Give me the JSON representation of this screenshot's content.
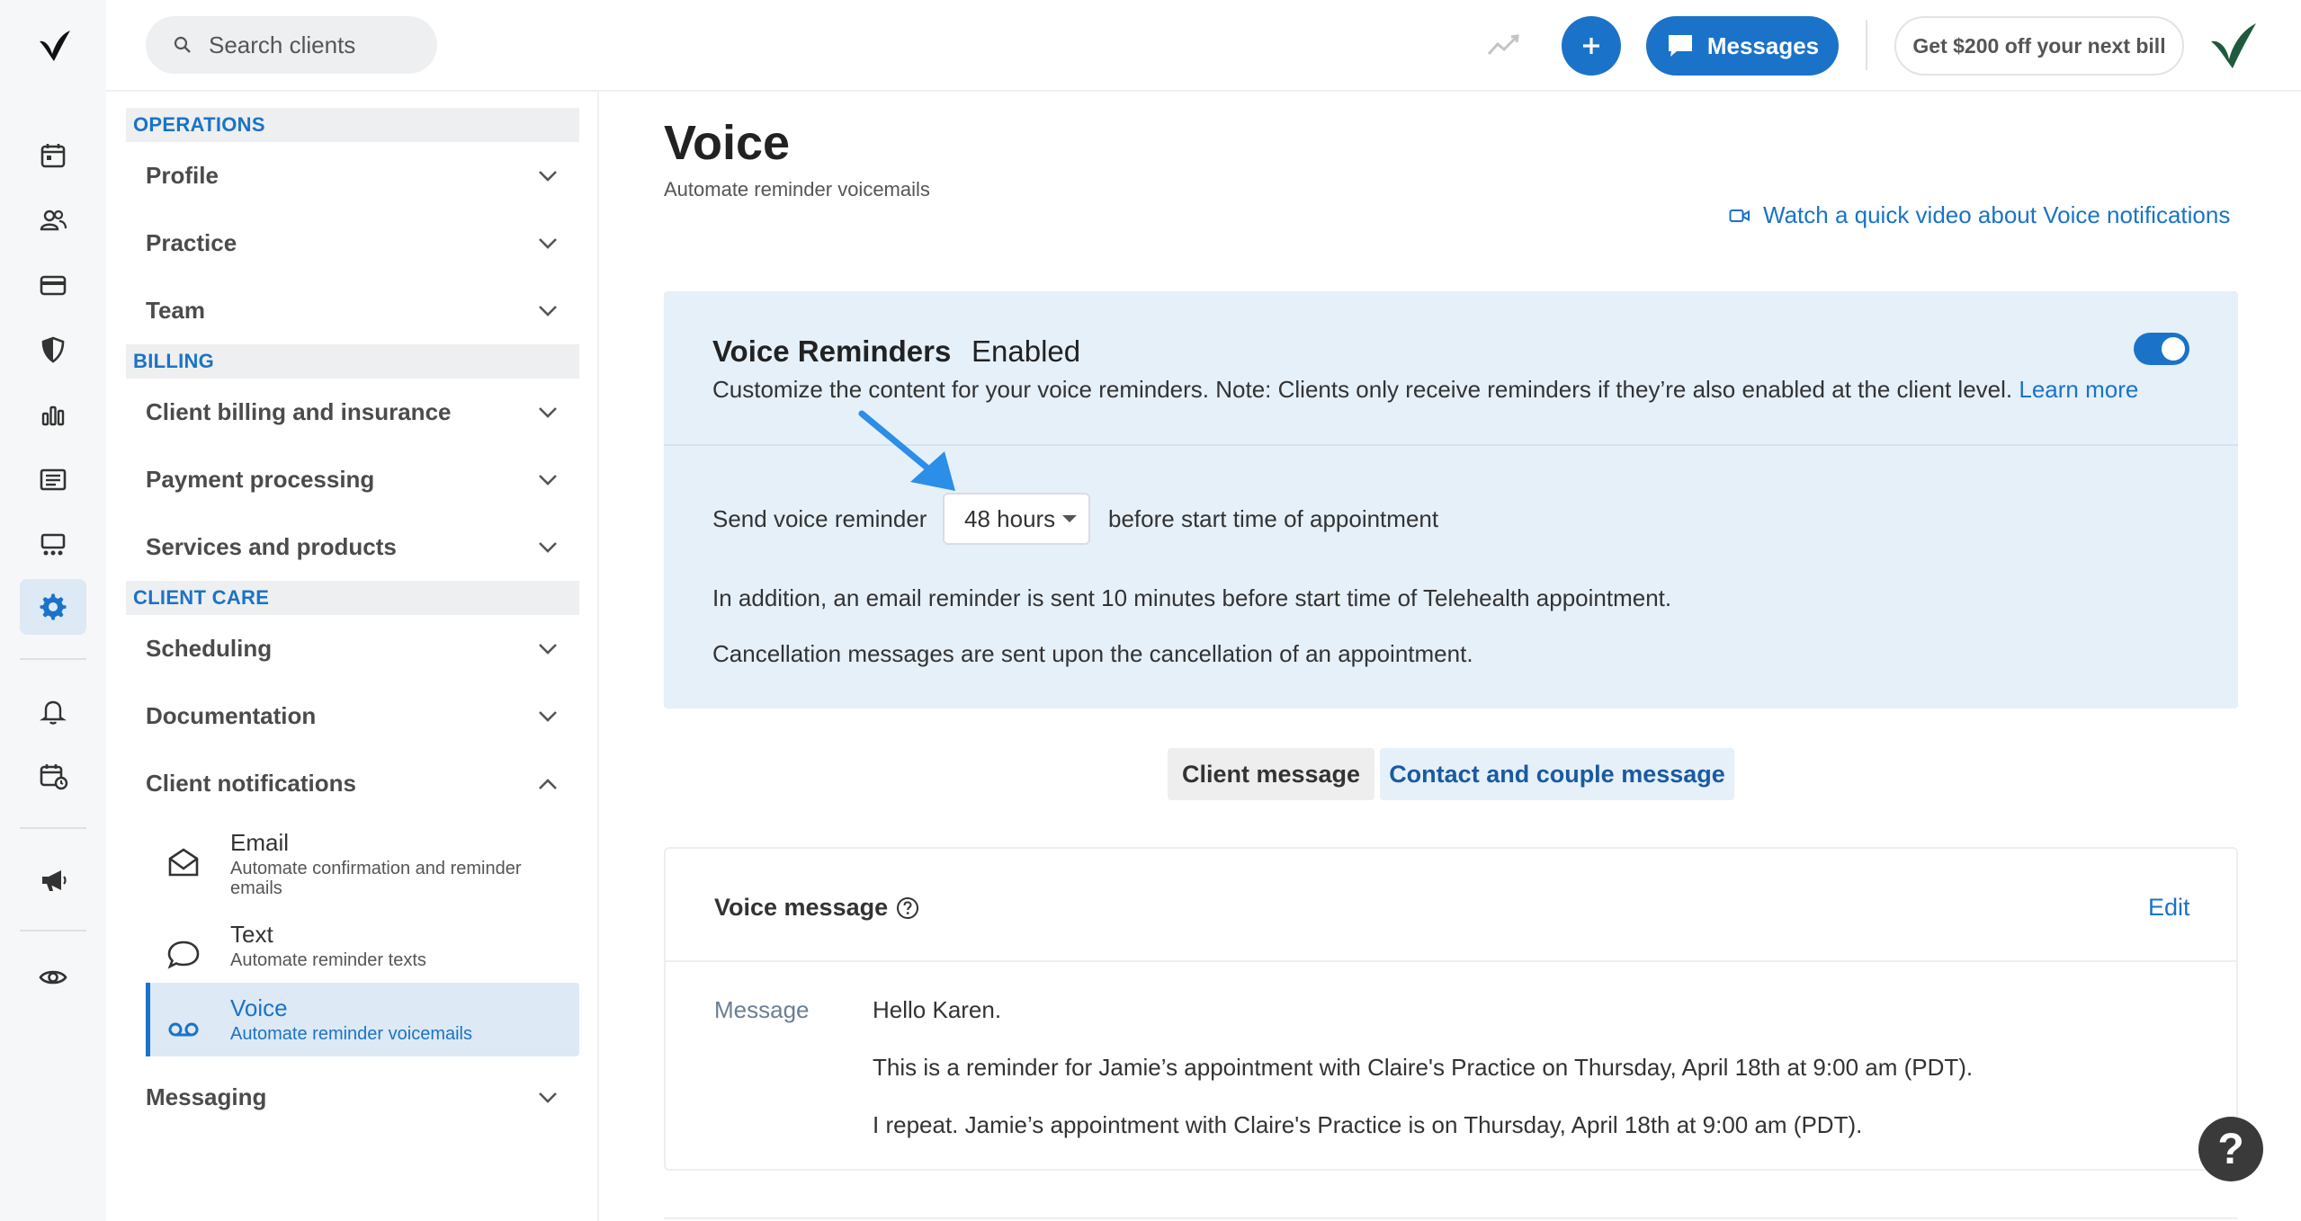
{
  "topbar": {
    "search_placeholder": "Search clients",
    "messages_label": "Messages",
    "promo_label": "Get $200 off your next bill"
  },
  "rail": {
    "icons": [
      "calendar-icon",
      "clients-icon",
      "billing-card-icon",
      "insurance-shield-icon",
      "analytics-icon",
      "documents-icon",
      "marketplace-icon",
      "settings-gear-icon",
      "notifications-bell-icon",
      "reminders-calendar-icon",
      "announcements-megaphone-icon",
      "visibility-eye-icon"
    ],
    "active": "settings-gear-icon"
  },
  "nav": {
    "operations": {
      "heading": "OPERATIONS",
      "items": [
        {
          "label": "Profile"
        },
        {
          "label": "Practice"
        },
        {
          "label": "Team"
        }
      ]
    },
    "billing": {
      "heading": "BILLING",
      "items": [
        {
          "label": "Client billing and insurance"
        },
        {
          "label": "Payment processing"
        },
        {
          "label": "Services and products"
        }
      ]
    },
    "client_care": {
      "heading": "CLIENT CARE",
      "items": [
        {
          "label": "Scheduling"
        },
        {
          "label": "Documentation"
        },
        {
          "label": "Client notifications"
        }
      ],
      "notifications_sub": [
        {
          "title": "Email",
          "desc": "Automate confirmation and reminder emails"
        },
        {
          "title": "Text",
          "desc": "Automate reminder texts"
        },
        {
          "title": "Voice",
          "desc": "Automate reminder voicemails"
        }
      ],
      "messaging": {
        "label": "Messaging"
      }
    }
  },
  "main": {
    "title": "Voice",
    "subtitle": "Automate reminder voicemails",
    "video_link": "Watch a quick video about Voice notifications",
    "reminders": {
      "title": "Voice Reminders",
      "status": "Enabled",
      "enabled": true,
      "description": "Customize the content for your voice reminders. Note: Clients only receive reminders if they’re also enabled at the client level.",
      "learn_more": "Learn more",
      "send_label": "Send voice reminder",
      "hours_value": "48 hours",
      "after_label": "before start time of appointment",
      "para1": "In addition, an email reminder is sent 10 minutes before start time of Telehealth appointment.",
      "para2": "Cancellation messages are sent upon the cancellation of an appointment."
    },
    "tabs": [
      {
        "label": "Client message",
        "active": true
      },
      {
        "label": "Contact and couple message",
        "active": false
      }
    ],
    "voice_message": {
      "title": "Voice message",
      "edit_label": "Edit",
      "message_label": "Message",
      "lines": [
        "Hello Karen.",
        "This is a reminder for Jamie’s appointment with Claire's Practice on Thursday, April 18th at 9:00 am (PDT).",
        "I repeat. Jamie’s appointment with Claire's Practice is on Thursday, April 18th at 9:00 am (PDT)."
      ]
    },
    "help_label": "?"
  },
  "colors": {
    "accent": "#1a73c8",
    "panel_bg": "#e6f0f9",
    "arrow": "#2b8ee8"
  }
}
